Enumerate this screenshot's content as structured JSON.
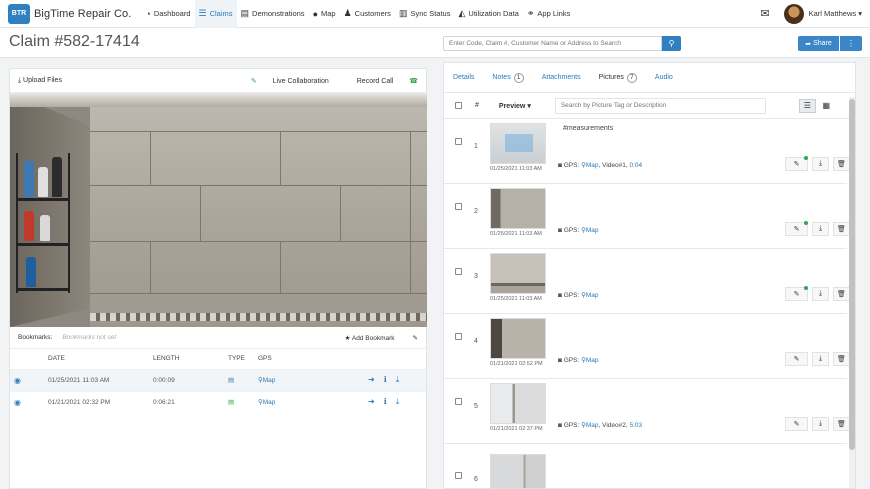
{
  "app": {
    "logo_mark": "BTR",
    "name": "BigTime Repair Co."
  },
  "nav": [
    {
      "label": "Dashboard",
      "icon": "dashboard-icon",
      "glyph": "◔",
      "active": false
    },
    {
      "label": "Claims",
      "icon": "claims-icon",
      "glyph": "☰",
      "active": true
    },
    {
      "label": "Demonstrations",
      "icon": "film-icon",
      "glyph": "▤",
      "active": false
    },
    {
      "label": "Map",
      "icon": "globe-icon",
      "glyph": "●",
      "active": false
    },
    {
      "label": "Customers",
      "icon": "users-icon",
      "glyph": "♟",
      "active": false
    },
    {
      "label": "Sync Status",
      "icon": "bar-chart-icon",
      "glyph": "▥",
      "active": false
    },
    {
      "label": "Utilization Data",
      "icon": "area-chart-icon",
      "glyph": "◭",
      "active": false
    },
    {
      "label": "App Links",
      "icon": "link-icon",
      "glyph": "⚭",
      "active": false
    }
  ],
  "user": {
    "name": "Karl Matthews ▾"
  },
  "page": {
    "title": "Claim #582-17414"
  },
  "search": {
    "placeholder": "Enter Code, Claim #, Customer Name or Address to Search"
  },
  "share": {
    "label": "Share"
  },
  "left": {
    "upload_label": "Upload Files",
    "live_label": "Live Collaboration",
    "record_label": "Record Call",
    "bookmarks_label": "Bookmarks:",
    "bookmarks_empty": "Bookmarks not set",
    "add_bookmark_label": "Add Bookmark",
    "columns": [
      "DATE",
      "LENGTH",
      "TYPE",
      "GPS"
    ],
    "recordings": [
      {
        "date": "01/25/2021 11:03 AM",
        "length": "0:00:09",
        "type_color": "#2f7fc1",
        "gps": "Map"
      },
      {
        "date": "01/21/2021 02:32 PM",
        "length": "0:06:21",
        "type_color": "#33a853",
        "gps": "Map"
      }
    ]
  },
  "right": {
    "tabs": [
      {
        "label": "Details",
        "badge": ""
      },
      {
        "label": "Notes",
        "badge": "1"
      },
      {
        "label": "Attachments",
        "badge": ""
      },
      {
        "label": "Pictures",
        "badge": "7",
        "active": true
      },
      {
        "label": "Audio",
        "badge": ""
      }
    ],
    "col_number": "#",
    "col_preview": "Preview ▾",
    "pic_search_placeholder": "Search by Picture Tag or Description",
    "pictures": [
      {
        "number": "1",
        "timestamp": "01/25/2021 11:03 AM",
        "tag": "#measurements",
        "gps_label": "GPS:",
        "map": "Map",
        "video_text": ", Video#1, ",
        "video_time": "0:04"
      },
      {
        "number": "2",
        "timestamp": "01/25/2021 11:03 AM",
        "tag": "",
        "gps_label": "GPS:",
        "map": "Map",
        "video_text": "",
        "video_time": ""
      },
      {
        "number": "3",
        "timestamp": "01/25/2021 11:03 AM",
        "tag": "",
        "gps_label": "GPS:",
        "map": "Map",
        "video_text": "",
        "video_time": ""
      },
      {
        "number": "4",
        "timestamp": "01/21/2021 02:52 PM",
        "tag": "",
        "gps_label": "GPS:",
        "map": "Map",
        "video_text": "",
        "video_time": ""
      },
      {
        "number": "5",
        "timestamp": "01/21/2021 02:37 PM",
        "tag": "",
        "gps_label": "GPS:",
        "map": "Map",
        "video_text": ", Video#2, ",
        "video_time": "5:03"
      },
      {
        "number": "6",
        "timestamp": "",
        "tag": "",
        "gps_label": "",
        "map": "",
        "video_text": "",
        "video_time": ""
      }
    ]
  }
}
